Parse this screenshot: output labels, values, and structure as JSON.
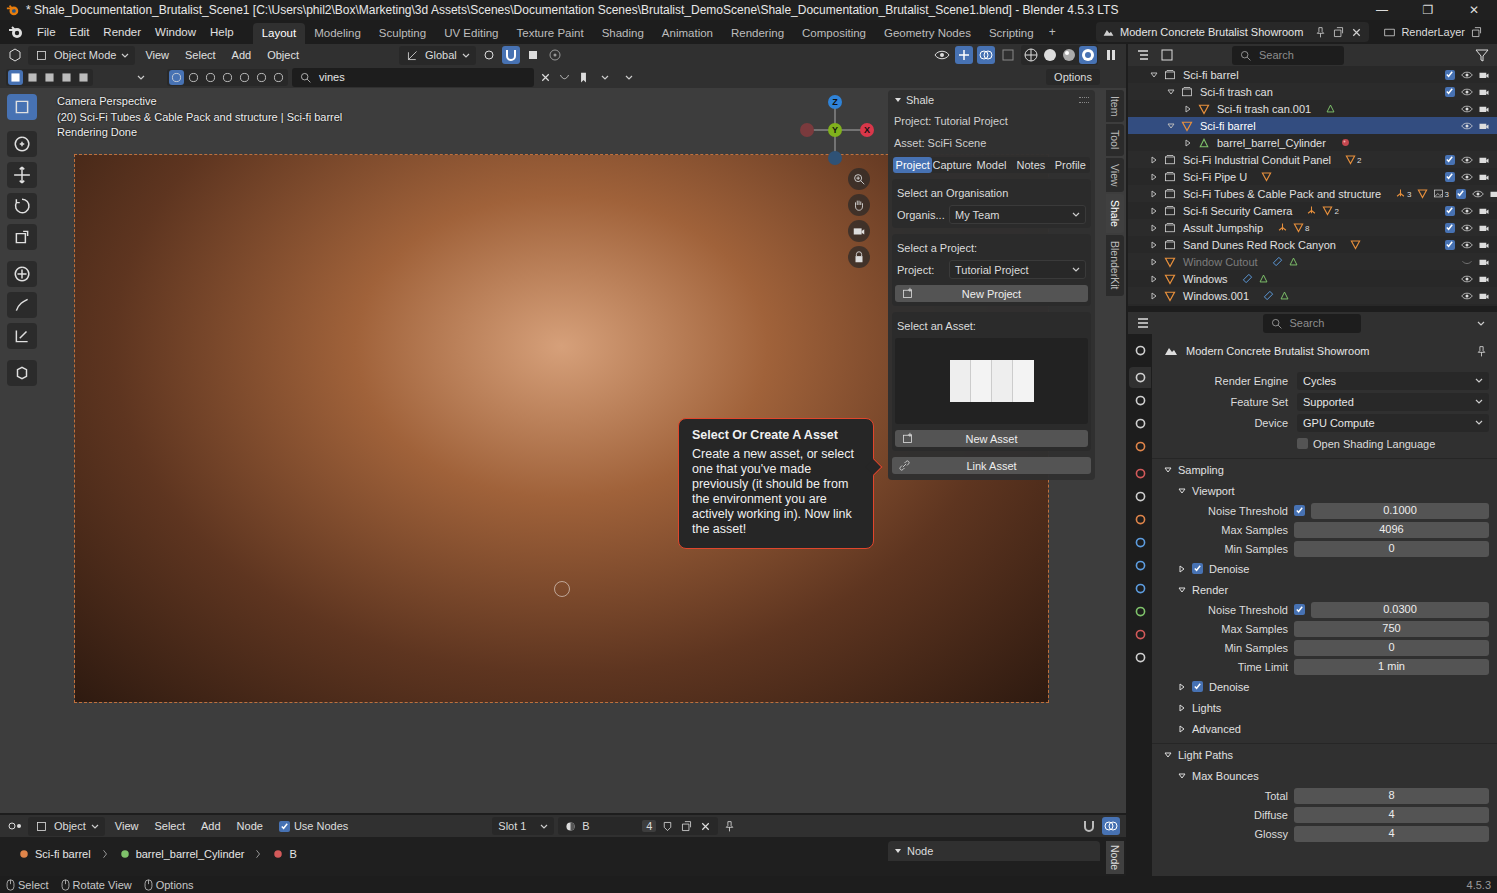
{
  "window": {
    "title": "* Shale_Documentation_Brutalist_Scene1 [C:\\Users\\phil2\\Box\\Marketing\\3d Assets\\Scenes\\Documentation Scenes\\Brutalist_DemoScene\\Shale_Documentation_Brutalist_Scene1.blend] - Blender 4.5.3 LTS",
    "controls": [
      "—",
      "❐",
      "✕"
    ]
  },
  "menus": [
    "File",
    "Edit",
    "Render",
    "Window",
    "Help"
  ],
  "workspaces": [
    {
      "label": "Layout",
      "selected": true
    },
    {
      "label": "Modeling",
      "selected": false
    },
    {
      "label": "Sculpting",
      "selected": false
    },
    {
      "label": "UV Editing",
      "selected": false
    },
    {
      "label": "Texture Paint",
      "selected": false
    },
    {
      "label": "Shading",
      "selected": false
    },
    {
      "label": "Animation",
      "selected": false
    },
    {
      "label": "Rendering",
      "selected": false
    },
    {
      "label": "Compositing",
      "selected": false
    },
    {
      "label": "Geometry Nodes",
      "selected": false
    },
    {
      "label": "Scripting",
      "selected": false
    }
  ],
  "add_workspace": "+",
  "scene": "Modern Concrete Brutalist Showroom",
  "view_layer": "RenderLayer",
  "viewport": {
    "mode": "Object Mode",
    "menus": [
      "View",
      "Select",
      "Add",
      "Object"
    ],
    "orientation": "Global",
    "search": "vines",
    "options": "Options",
    "overlay_lines": [
      "Camera Perspective",
      "(20) Sci-Fi Tubes & Cable Pack and structure | Sci-fi barrel",
      "Rendering Done"
    ],
    "gizmo": {
      "z": "Z",
      "y": "Y",
      "x": "X"
    },
    "tools": [
      {
        "selected": true
      },
      {
        "selected": false
      },
      {
        "selected": false
      },
      {
        "selected": false
      },
      {
        "selected": false
      },
      {
        "selected": false
      },
      {
        "selected": false
      },
      {
        "selected": false
      },
      {
        "selected": false
      }
    ],
    "side_tabs": [
      {
        "label": "Item",
        "selected": false
      },
      {
        "label": "Tool",
        "selected": false
      },
      {
        "label": "View",
        "selected": false
      },
      {
        "label": "Shale",
        "selected": true
      },
      {
        "label": "BlenderKit",
        "selected": false
      }
    ]
  },
  "shale": {
    "title": "Shale",
    "project_line": "Project: Tutorial Project",
    "asset_line": "Asset: SciFi Scene",
    "tabs": [
      {
        "label": "Project",
        "selected": true
      },
      {
        "label": "Capture",
        "selected": false
      },
      {
        "label": "Model",
        "selected": false
      },
      {
        "label": "Notes",
        "selected": false
      },
      {
        "label": "Profile",
        "selected": false
      }
    ],
    "org_heading": "Select an Organisation",
    "org_label": "Organis...",
    "org_value": "My Team",
    "project_heading": "Select a Project:",
    "project_label": "Project:",
    "project_value": "Tutorial Project",
    "new_project": "New Project",
    "asset_heading": "Select an Asset:",
    "new_asset": "New Asset",
    "link_asset": "Link Asset"
  },
  "tooltip": {
    "title": "Select Or Create A Asset",
    "body": "Create a new asset, or select one that you've made previously (it should be from the environment you are actively working in). Now link the asset!"
  },
  "outliner": {
    "search": "Search",
    "rows": [
      {
        "name": "Sci-fi barrel",
        "depth": 0,
        "icon": "collection",
        "expanded": true,
        "selected": false,
        "disabled": false,
        "has_checkbox": true,
        "checked": true,
        "toggles": true,
        "visible": true,
        "extras": []
      },
      {
        "name": "Sci-fi trash can",
        "depth": 1,
        "icon": "collection",
        "expanded": true,
        "selected": false,
        "disabled": false,
        "has_checkbox": true,
        "checked": true,
        "toggles": true,
        "visible": true,
        "extras": []
      },
      {
        "name": "Sci-fi trash can.001",
        "depth": 2,
        "icon": "object",
        "expanded": false,
        "selected": false,
        "disabled": false,
        "has_checkbox": false,
        "checked": false,
        "toggles": true,
        "visible": true,
        "extras": [
          {
            "kind": "mesh"
          }
        ]
      },
      {
        "name": "Sci-fi barrel",
        "depth": 1,
        "icon": "object",
        "expanded": true,
        "selected": true,
        "disabled": false,
        "has_checkbox": false,
        "checked": false,
        "toggles": true,
        "visible": true,
        "extras": []
      },
      {
        "name": "barrel_barrel_Cylinder",
        "depth": 2,
        "icon": "mesh",
        "expanded": false,
        "selected": false,
        "disabled": false,
        "has_checkbox": false,
        "checked": false,
        "toggles": false,
        "visible": true,
        "extras": [
          {
            "kind": "material"
          }
        ]
      },
      {
        "name": "Sci-Fi Industrial Conduit Panel",
        "depth": 0,
        "icon": "collection",
        "expanded": false,
        "selected": false,
        "disabled": false,
        "has_checkbox": true,
        "checked": true,
        "toggles": true,
        "visible": true,
        "extras": [
          {
            "kind": "object",
            "badge": "2"
          }
        ]
      },
      {
        "name": "Sci-Fi Pipe U",
        "depth": 0,
        "icon": "collection",
        "expanded": false,
        "selected": false,
        "disabled": false,
        "has_checkbox": true,
        "checked": true,
        "toggles": true,
        "visible": true,
        "extras": [
          {
            "kind": "object"
          }
        ]
      },
      {
        "name": "Sci-Fi Tubes & Cable Pack and structure",
        "depth": 0,
        "icon": "collection",
        "expanded": false,
        "selected": false,
        "disabled": false,
        "has_checkbox": true,
        "checked": true,
        "toggles": true,
        "visible": true,
        "extras": [
          {
            "kind": "empty",
            "badge": "3"
          },
          {
            "kind": "object"
          },
          {
            "kind": "image",
            "badge": "3"
          }
        ]
      },
      {
        "name": "Sci-fi Security Camera",
        "depth": 0,
        "icon": "collection",
        "expanded": false,
        "selected": false,
        "disabled": false,
        "has_checkbox": true,
        "checked": true,
        "toggles": true,
        "visible": true,
        "extras": [
          {
            "kind": "empty"
          },
          {
            "kind": "object",
            "badge": "2"
          }
        ]
      },
      {
        "name": "Assult Jumpship",
        "depth": 0,
        "icon": "collection",
        "expanded": false,
        "selected": false,
        "disabled": false,
        "has_checkbox": true,
        "checked": true,
        "toggles": true,
        "visible": true,
        "extras": [
          {
            "kind": "empty"
          },
          {
            "kind": "object",
            "badge": "8"
          }
        ]
      },
      {
        "name": "Sand Dunes Red Rock Canyon",
        "depth": 0,
        "icon": "collection",
        "expanded": false,
        "selected": false,
        "disabled": false,
        "has_checkbox": true,
        "checked": true,
        "toggles": true,
        "visible": true,
        "extras": [
          {
            "kind": "object"
          }
        ]
      },
      {
        "name": "Window Cutout",
        "depth": 0,
        "icon": "object",
        "expanded": false,
        "selected": false,
        "disabled": true,
        "has_checkbox": false,
        "checked": false,
        "toggles": true,
        "visible": false,
        "extras": [
          {
            "kind": "modifier"
          },
          {
            "kind": "mesh"
          }
        ]
      },
      {
        "name": "Windows",
        "depth": 0,
        "icon": "object",
        "expanded": false,
        "selected": false,
        "disabled": false,
        "has_checkbox": false,
        "checked": false,
        "toggles": true,
        "visible": true,
        "extras": [
          {
            "kind": "modifier"
          },
          {
            "kind": "mesh"
          }
        ]
      },
      {
        "name": "Windows.001",
        "depth": 0,
        "icon": "object",
        "expanded": false,
        "selected": false,
        "disabled": false,
        "has_checkbox": false,
        "checked": false,
        "toggles": true,
        "visible": true,
        "extras": [
          {
            "kind": "modifier"
          },
          {
            "kind": "mesh"
          }
        ]
      }
    ]
  },
  "properties": {
    "search": "Search",
    "title": "Modern Concrete Brutalist Showroom",
    "tabs": [
      {
        "selected": false
      },
      {
        "selected": true
      },
      {
        "selected": false
      },
      {
        "selected": false
      },
      {
        "selected": false
      },
      {
        "selected": false
      },
      {
        "selected": false
      },
      {
        "selected": false
      },
      {
        "selected": false
      },
      {
        "selected": false
      },
      {
        "selected": false
      },
      {
        "selected": false
      },
      {
        "selected": false
      },
      {
        "selected": false
      }
    ],
    "rows": [
      {
        "kind": "dropdown",
        "label": "Render Engine",
        "value": "Cycles"
      },
      {
        "kind": "dropdown",
        "label": "Feature Set",
        "value": "Supported"
      },
      {
        "kind": "dropdown",
        "label": "Device",
        "value": "GPU Compute"
      },
      {
        "kind": "checkbox",
        "label": "Open Shading Language",
        "checked": false
      },
      {
        "kind": "section",
        "label": "Sampling",
        "depth": 0,
        "expanded": true,
        "has_checkbox": false,
        "checked": false
      },
      {
        "kind": "section",
        "label": "Viewport",
        "depth": 1,
        "expanded": true,
        "has_checkbox": false,
        "checked": false
      },
      {
        "kind": "number",
        "label": "Noise Threshold",
        "value": "0.1000",
        "has_checkbox": true,
        "checked": true
      },
      {
        "kind": "number",
        "label": "Max Samples",
        "value": "4096",
        "has_checkbox": false,
        "checked": false
      },
      {
        "kind": "number",
        "label": "Min Samples",
        "value": "0",
        "has_checkbox": false,
        "checked": false
      },
      {
        "kind": "section",
        "label": "Denoise",
        "depth": 1,
        "expanded": false,
        "has_checkbox": true,
        "checked": true
      },
      {
        "kind": "section",
        "label": "Render",
        "depth": 1,
        "expanded": true,
        "has_checkbox": false,
        "checked": false
      },
      {
        "kind": "number",
        "label": "Noise Threshold",
        "value": "0.0300",
        "has_checkbox": true,
        "checked": true
      },
      {
        "kind": "number",
        "label": "Max Samples",
        "value": "750",
        "has_checkbox": false,
        "checked": false
      },
      {
        "kind": "number",
        "label": "Min Samples",
        "value": "0",
        "has_checkbox": false,
        "checked": false
      },
      {
        "kind": "number",
        "label": "Time Limit",
        "value": "1 min",
        "has_checkbox": false,
        "checked": false
      },
      {
        "kind": "section",
        "label": "Denoise",
        "depth": 1,
        "expanded": false,
        "has_checkbox": true,
        "checked": true
      },
      {
        "kind": "section",
        "label": "Lights",
        "depth": 1,
        "expanded": false,
        "has_checkbox": false,
        "checked": false
      },
      {
        "kind": "section",
        "label": "Advanced",
        "depth": 1,
        "expanded": false,
        "has_checkbox": false,
        "checked": false
      },
      {
        "kind": "section",
        "label": "Light Paths",
        "depth": 0,
        "expanded": true,
        "has_checkbox": false,
        "checked": false
      },
      {
        "kind": "section",
        "label": "Max Bounces",
        "depth": 1,
        "expanded": true,
        "has_checkbox": false,
        "checked": false
      },
      {
        "kind": "number",
        "label": "Total",
        "value": "8",
        "has_checkbox": false,
        "checked": false
      },
      {
        "kind": "number",
        "label": "Diffuse",
        "value": "4",
        "has_checkbox": false,
        "checked": false
      },
      {
        "kind": "number",
        "label": "Glossy",
        "value": "4",
        "has_checkbox": false,
        "checked": false
      }
    ]
  },
  "node_editor": {
    "editor": "Object",
    "menus": [
      "View",
      "Select",
      "Add",
      "Node"
    ],
    "use_nodes": {
      "label": "Use Nodes",
      "checked": true
    },
    "slot": "Slot 1",
    "material": "B",
    "users": "4",
    "breadcrumb": [
      "Sci-fi barrel",
      "barrel_barrel_Cylinder",
      "B"
    ],
    "panel_title": "Node",
    "side_tab": "Node"
  },
  "status_bar": {
    "items": [
      "Select",
      "Rotate View",
      "Options"
    ],
    "version": "4.5.3"
  }
}
